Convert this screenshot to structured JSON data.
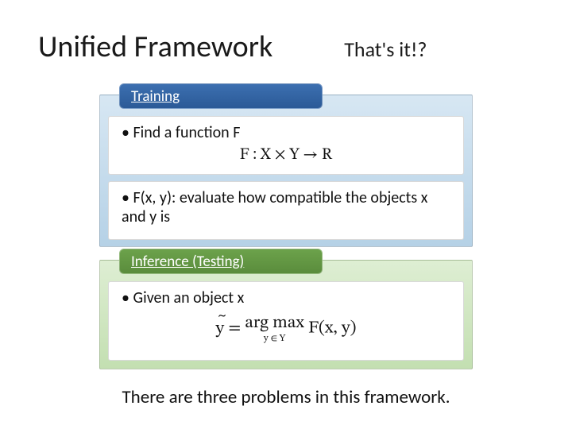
{
  "title": "Unified Framework",
  "subtitle": "That's it!?",
  "training": {
    "tab": "Training",
    "bullet1": "• Find a function F",
    "formula1": "F : X × Y → R",
    "bullet2": "• F(x, y): evaluate how compatible the objects x and y is"
  },
  "inference": {
    "tab": "Inference (Testing)",
    "bullet1": "• Given an object x",
    "formula_lhs": "y",
    "formula_eq": " = ",
    "formula_argmax": "arg max",
    "formula_sub": "y ∈ Y",
    "formula_rhs": " F(x, y)"
  },
  "footer": "There are three problems in this framework."
}
